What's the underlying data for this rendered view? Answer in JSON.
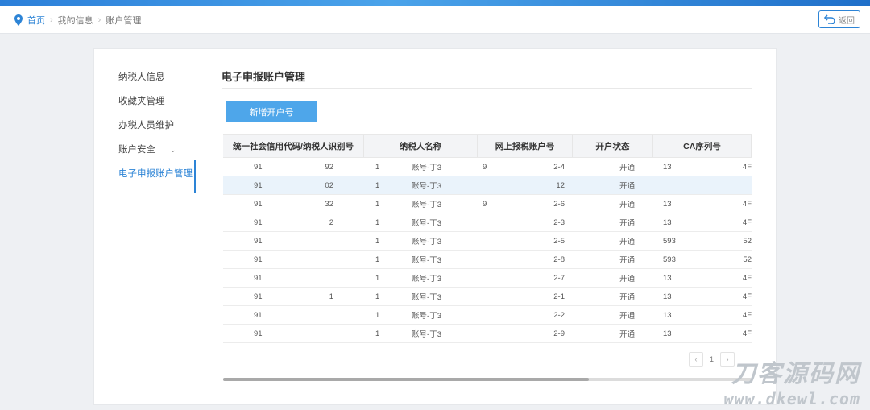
{
  "breadcrumb": {
    "home": "首页",
    "level2": "我的信息",
    "level3": "账户管理"
  },
  "back_label": "返回",
  "sidebar": {
    "items": [
      {
        "label": "纳税人信息"
      },
      {
        "label": "收藏夹管理"
      },
      {
        "label": "办税人员维护"
      },
      {
        "label": "账户安全"
      },
      {
        "label": "电子申报账户管理"
      }
    ]
  },
  "page": {
    "title": "电子申报账户管理",
    "add_button": "新增开户号"
  },
  "table": {
    "headers": [
      "统一社会信用代码/纳税人识别号",
      "纳税人名称",
      "网上报税账户号",
      "开户状态",
      "CA序列号"
    ],
    "rows": [
      {
        "code_a": "91",
        "code_b": "92",
        "name_a": "1",
        "name_b": "账号-丁3",
        "acct_a": "9",
        "acct_b": "2-4",
        "status": "开通",
        "ca_a": "13",
        "ca_b": "4F"
      },
      {
        "code_a": "91",
        "code_b": "02",
        "name_a": "1",
        "name_b": "账号-丁3",
        "acct_a": "",
        "acct_b": "12",
        "status": "开通",
        "ca_a": "",
        "ca_b": ""
      },
      {
        "code_a": "91",
        "code_b": "32",
        "name_a": "1",
        "name_b": "账号-丁3",
        "acct_a": "9",
        "acct_b": "2-6",
        "status": "开通",
        "ca_a": "13",
        "ca_b": "4F"
      },
      {
        "code_a": "91",
        "code_b": "2",
        "name_a": "1",
        "name_b": "账号-丁3",
        "acct_a": "",
        "acct_b": "2-3",
        "status": "开通",
        "ca_a": "13",
        "ca_b": "4F"
      },
      {
        "code_a": "91",
        "code_b": "",
        "name_a": "1",
        "name_b": "账号-丁3",
        "acct_a": "",
        "acct_b": "2-5",
        "status": "开通",
        "ca_a": "593",
        "ca_b": "52"
      },
      {
        "code_a": "91",
        "code_b": "",
        "name_a": "1",
        "name_b": "账号-丁3",
        "acct_a": "",
        "acct_b": "2-8",
        "status": "开通",
        "ca_a": "593",
        "ca_b": "52"
      },
      {
        "code_a": "91",
        "code_b": "",
        "name_a": "1",
        "name_b": "账号-丁3",
        "acct_a": "",
        "acct_b": "2-7",
        "status": "开通",
        "ca_a": "13",
        "ca_b": "4F"
      },
      {
        "code_a": "91",
        "code_b": "1",
        "name_a": "1",
        "name_b": "账号-丁3",
        "acct_a": "",
        "acct_b": "2-1",
        "status": "开通",
        "ca_a": "13",
        "ca_b": "4F"
      },
      {
        "code_a": "91",
        "code_b": "",
        "name_a": "1",
        "name_b": "账号-丁3",
        "acct_a": "",
        "acct_b": "2-2",
        "status": "开通",
        "ca_a": "13",
        "ca_b": "4F"
      },
      {
        "code_a": "91",
        "code_b": "",
        "name_a": "1",
        "name_b": "账号-丁3",
        "acct_a": "",
        "acct_b": "2-9",
        "status": "开通",
        "ca_a": "13",
        "ca_b": "4F"
      }
    ]
  },
  "pager": {
    "current": "1"
  },
  "watermark": {
    "line1": "刀客源码网",
    "line2": "www.dkewl.com"
  },
  "colors": {
    "accent": "#2d84d6",
    "button": "#4ea6ea",
    "highlight_row": "#eaf3fb"
  }
}
